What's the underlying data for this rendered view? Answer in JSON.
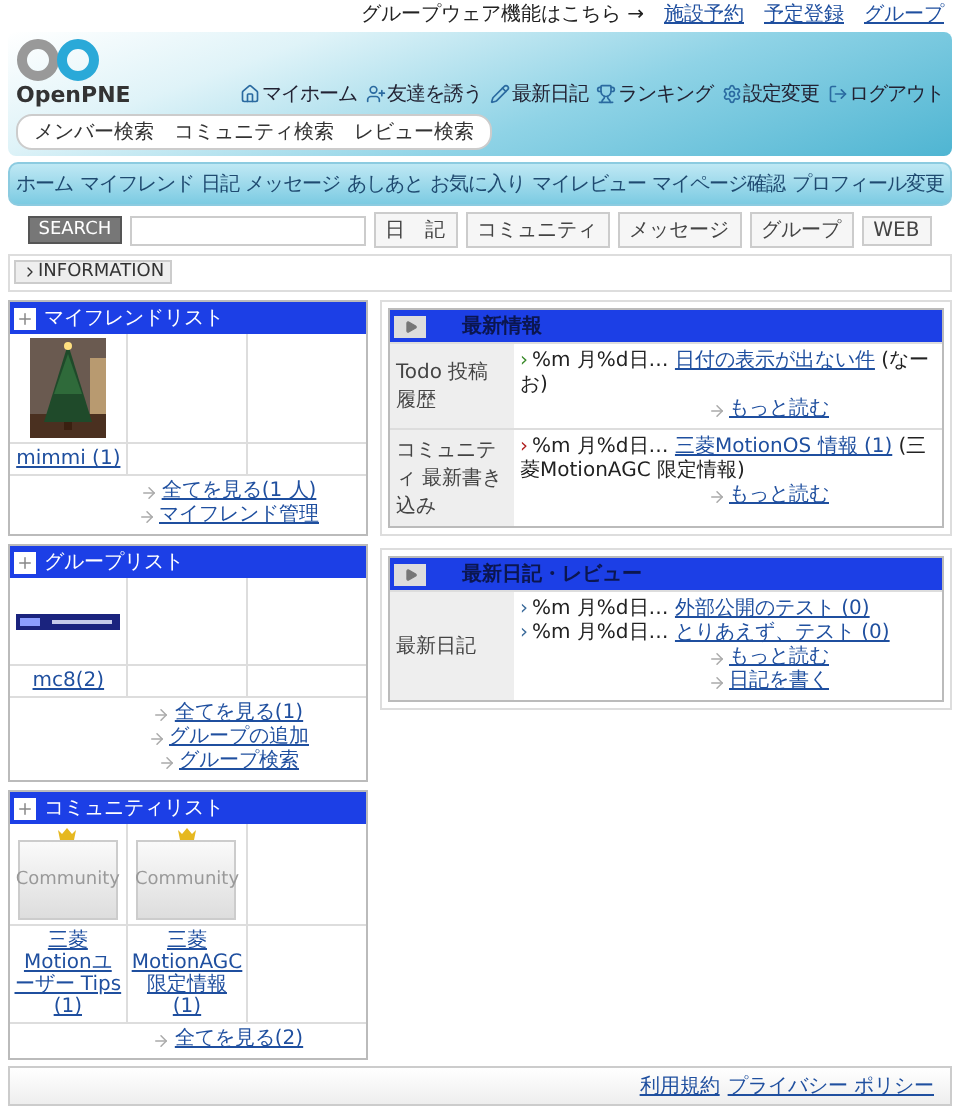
{
  "top_links": {
    "lead": "グループウェア機能はこちら →",
    "links": [
      "施設予約",
      "予定登録",
      "グループ"
    ]
  },
  "header": {
    "logo": "OpenPNE",
    "search_links": [
      "メンバー検索",
      "コミュニティ検索",
      "レビュー検索"
    ],
    "my_links": [
      "マイホーム",
      "友達を誘う",
      "最新日記",
      "ランキング",
      "設定変更",
      "ログアウト"
    ]
  },
  "nav": [
    "ホーム",
    "マイフレンド",
    "日記",
    "メッセージ",
    "あしあと",
    "お気に入り",
    "マイレビュー",
    "マイページ確認",
    "プロフィール変更"
  ],
  "search": {
    "button": "SEARCH",
    "targets": [
      "日　記",
      "コミュニティ",
      "メッセージ",
      "グループ",
      "WEB"
    ]
  },
  "info_bar": "INFORMATION",
  "friend_list": {
    "title": "マイフレンドリスト",
    "members": [
      {
        "name": "mimmi (1)",
        "kind": "picture"
      }
    ],
    "links": [
      "全てを見る(1 人)",
      "マイフレンド管理"
    ]
  },
  "group_list": {
    "title": "グループリスト",
    "groups": [
      {
        "name": "mc8(2)",
        "kind": "picture"
      }
    ],
    "links": [
      "全てを見る(1)",
      "グループの追加",
      "グループ検索"
    ]
  },
  "community_list": {
    "title": "コミュニティリスト",
    "communities": [
      {
        "name": "三菱Motionユーザー Tips (1)",
        "admin": true,
        "image_label": "Community"
      },
      {
        "name": "三菱 MotionAGC限定情報 (1)",
        "admin": true,
        "image_label": "Community"
      }
    ],
    "links": [
      "全てを見る(2)"
    ]
  },
  "latest_info": {
    "title": "最新情報",
    "rows": [
      {
        "label": "Todo 投稿履歴",
        "entries": [
          {
            "marker": "›",
            "date": "%m 月%d日…",
            "link": "日付の表示が出ない件",
            "suffix": "(なーお)",
            "color": "#3a8a2a"
          }
        ],
        "more": [
          "もっと読む"
        ]
      },
      {
        "label": "コミュニティ 最新書き込み",
        "entries": [
          {
            "marker": "›",
            "date": "%m 月%d日…",
            "link": "三菱MotionOS 情報 (1)",
            "suffix": "(三菱MotionAGC 限定情報)",
            "color": "#b02020"
          }
        ],
        "more": [
          "もっと読む"
        ]
      }
    ]
  },
  "latest_diary": {
    "title": "最新日記・レビュー",
    "rows": [
      {
        "label": "最新日記",
        "entries": [
          {
            "marker": "›",
            "date": "%m 月%d日…",
            "link": "外部公開のテスト (0)",
            "color": "#3a6a9a"
          },
          {
            "marker": "›",
            "date": "%m 月%d日…",
            "link": "とりあえず、テスト (0)",
            "color": "#3a6a9a"
          }
        ],
        "more": [
          "もっと読む",
          "日記を書く"
        ]
      }
    ]
  },
  "footer": [
    "利用規約",
    "プライバシー ポリシー"
  ]
}
